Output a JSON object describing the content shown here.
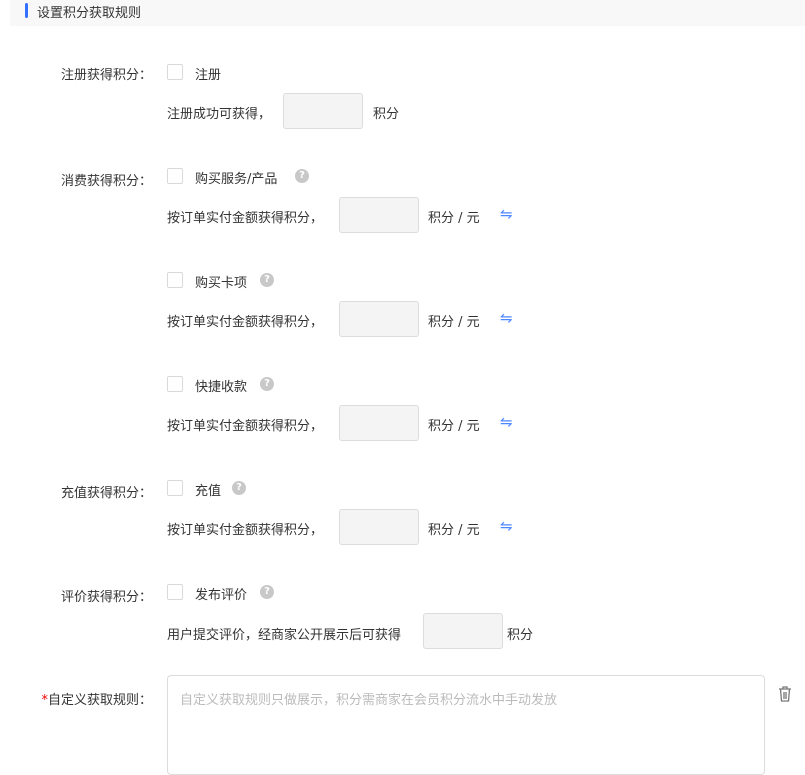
{
  "header": {
    "title": "设置积分获取规则"
  },
  "register": {
    "label": "注册获得积分：",
    "option": "注册",
    "prefix": "注册成功可获得，",
    "unit": "积分",
    "value": ""
  },
  "consume": {
    "label": "消费获得积分：",
    "items": [
      {
        "option": "购买服务/产品",
        "prefix": "按订单实付金额获得积分，",
        "unit": "积分 / 元",
        "value": ""
      },
      {
        "option": "购买卡项",
        "prefix": "按订单实付金额获得积分，",
        "unit": "积分 / 元",
        "value": ""
      },
      {
        "option": "快捷收款",
        "prefix": "按订单实付金额获得积分，",
        "unit": "积分 / 元",
        "value": ""
      }
    ]
  },
  "recharge": {
    "label": "充值获得积分：",
    "option": "充值",
    "prefix": "按订单实付金额获得积分，",
    "unit": "积分 / 元",
    "value": ""
  },
  "review": {
    "label": "评价获得积分：",
    "option": "发布评价",
    "prefix": "用户提交评价，经商家公开展示后可获得",
    "unit": "积分",
    "value": ""
  },
  "custom": {
    "required": "*",
    "label": "自定义获取规则：",
    "placeholder": "自定义获取规则只做展示，积分需商家在会员积分流水中手动发放"
  },
  "icons": {
    "help": "?",
    "swap": "⇋"
  }
}
